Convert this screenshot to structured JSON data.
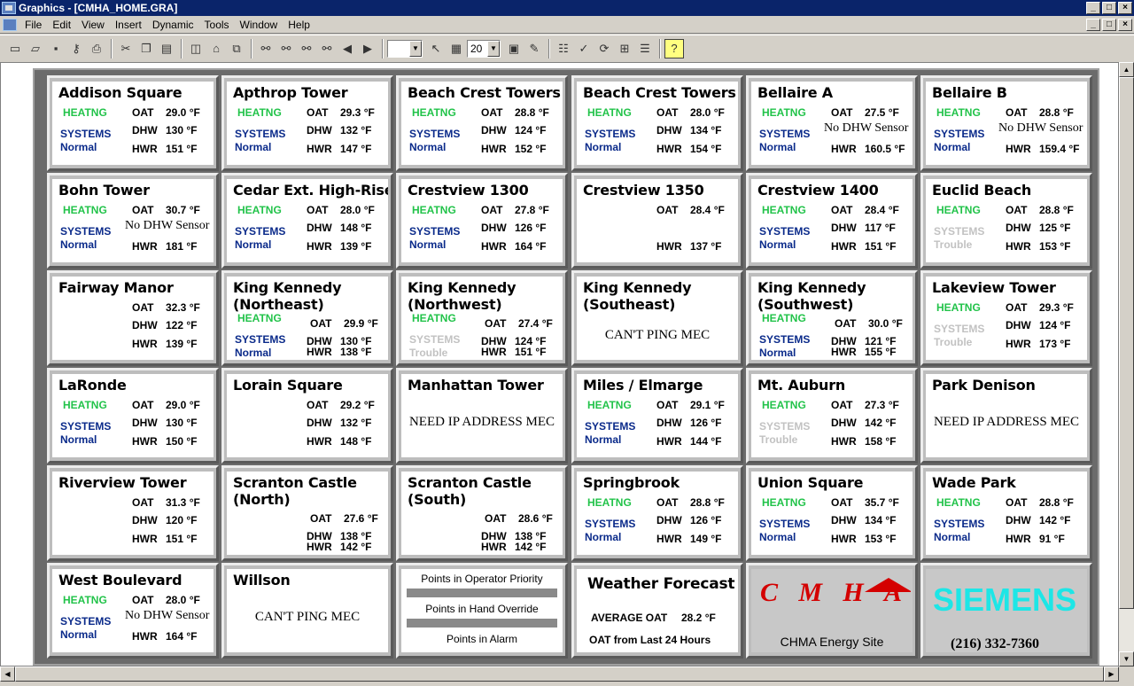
{
  "window": {
    "title": "Graphics - [CMHA_HOME.GRA]",
    "min": "_",
    "max": "□",
    "close": "×"
  },
  "menu": [
    "File",
    "Edit",
    "View",
    "Insert",
    "Dynamic",
    "Tools",
    "Window",
    "Help"
  ],
  "toolbar": {
    "zoom": "20"
  },
  "labels": {
    "oat": "OAT",
    "dhw": "DHW",
    "hwr": "HWR",
    "heating": "HEATNG",
    "systems": "SYSTEMS",
    "normal": "Normal",
    "trouble": "Trouble"
  },
  "buildings": [
    {
      "name": "Addison Square",
      "oat": "29.0 °F",
      "dhw": "130 °F",
      "hwr": "151 °F",
      "heating": true,
      "status": "Normal"
    },
    {
      "name": "Apthrop Tower",
      "oat": "29.3 °F",
      "dhw": "132 °F",
      "hwr": "147 °F",
      "heating": true,
      "status": "Normal"
    },
    {
      "name": "Beach Crest Towers A",
      "oat": "28.8 °F",
      "dhw": "124 °F",
      "hwr": "152 °F",
      "heating": true,
      "status": "Normal"
    },
    {
      "name": "Beach Crest Towers B",
      "oat": "28.0 °F",
      "dhw": "134 °F",
      "hwr": "154 °F",
      "heating": true,
      "status": "Normal"
    },
    {
      "name": "Bellaire A",
      "oat": "27.5 °F",
      "dhw_note": "No DHW Sensor",
      "hwr": "160.5 °F",
      "heating": true,
      "status": "Normal"
    },
    {
      "name": "Bellaire B",
      "oat": "28.8 °F",
      "dhw_note": "No DHW Sensor",
      "hwr": "159.4 °F",
      "heating": true,
      "status": "Normal"
    },
    {
      "name": "Bohn Tower",
      "oat": "30.7 °F",
      "dhw_note": "No DHW Sensor",
      "hwr": "181 °F",
      "heating": true,
      "status": "Normal"
    },
    {
      "name": "Cedar Ext. High-Rise",
      "oat": "28.0 °F",
      "dhw": "148 °F",
      "hwr": "139 °F",
      "heating": true,
      "status": "Normal"
    },
    {
      "name": "Crestview 1300",
      "oat": "27.8 °F",
      "dhw": "126 °F",
      "hwr": "164 °F",
      "heating": true,
      "status": "Normal"
    },
    {
      "name": "Crestview 1350",
      "oat": "28.4 °F",
      "hwr": "137 °F"
    },
    {
      "name": "Crestview 1400",
      "oat": "28.4 °F",
      "dhw": "117 °F",
      "hwr": "151 °F",
      "heating": true,
      "status": "Normal"
    },
    {
      "name": "Euclid Beach",
      "oat": "28.8 °F",
      "dhw": "125 °F",
      "hwr": "153 °F",
      "heating": true,
      "status": "Trouble"
    },
    {
      "name": "Fairway Manor",
      "oat": "32.3 °F",
      "dhw": "122 °F",
      "hwr": "139 °F"
    },
    {
      "name": "King Kennedy\n(Northeast)",
      "oat": "29.9 °F",
      "dhw": "130 °F",
      "hwr": "138 °F",
      "heating": true,
      "status": "Normal"
    },
    {
      "name": "King Kennedy\n(Northwest)",
      "oat": "27.4 °F",
      "dhw": "124 °F",
      "hwr": "151 °F",
      "heating": true,
      "status": "Trouble"
    },
    {
      "name": "King Kennedy\n(Southeast)",
      "message": "CAN'T PING MEC"
    },
    {
      "name": "King Kennedy\n(Southwest)",
      "oat": "30.0 °F",
      "dhw": "121 °F",
      "hwr": "155 °F",
      "heating": true,
      "status": "Normal"
    },
    {
      "name": "Lakeview Tower",
      "oat": "29.3 °F",
      "dhw": "124 °F",
      "hwr": "173 °F",
      "heating": true,
      "status": "Trouble"
    },
    {
      "name": "LaRonde",
      "oat": "29.0 °F",
      "dhw": "130 °F",
      "hwr": "150 °F",
      "heating": true,
      "status": "Normal"
    },
    {
      "name": "Lorain Square",
      "oat": "29.2 °F",
      "dhw": "132 °F",
      "hwr": "148 °F"
    },
    {
      "name": "Manhattan Tower",
      "message": "NEED IP ADDRESS MEC"
    },
    {
      "name": "Miles / Elmarge",
      "oat": "29.1 °F",
      "dhw": "126 °F",
      "hwr": "144 °F",
      "heating": true,
      "status": "Normal"
    },
    {
      "name": "Mt. Auburn",
      "oat": "27.3 °F",
      "dhw": "142 °F",
      "hwr": "158 °F",
      "heating": true,
      "status": "Trouble"
    },
    {
      "name": "Park Denison",
      "message": "NEED IP ADDRESS MEC"
    },
    {
      "name": "Riverview Tower",
      "oat": "31.3 °F",
      "dhw": "120 °F",
      "hwr": "151 °F"
    },
    {
      "name": "Scranton Castle\n(North)",
      "oat": "27.6 °F",
      "dhw": "138 °F",
      "hwr": "142 °F"
    },
    {
      "name": "Scranton Castle\n(South)",
      "oat": "28.6 °F",
      "dhw": "138 °F",
      "hwr": "142 °F"
    },
    {
      "name": "Springbrook",
      "oat": "28.8 °F",
      "dhw": "126 °F",
      "hwr": "149 °F",
      "heating": true,
      "status": "Normal"
    },
    {
      "name": "Union Square",
      "oat": "35.7 °F",
      "dhw": "134 °F",
      "hwr": "153 °F",
      "heating": true,
      "status": "Normal"
    },
    {
      "name": "Wade Park",
      "oat": "28.8 °F",
      "dhw": "142 °F",
      "hwr": "91 °F",
      "heating": true,
      "status": "Normal"
    },
    {
      "name": "West Boulevard",
      "oat": "28.0 °F",
      "dhw_note": "No DHW Sensor",
      "hwr": "164 °F",
      "heating": true,
      "status": "Normal"
    },
    {
      "name": "Willson",
      "message": "CAN'T PING MEC"
    }
  ],
  "points": {
    "priority": "Points in Operator Priority",
    "override": "Points in Hand Override",
    "alarm": "Points in Alarm"
  },
  "weather": {
    "title": "Weather Forecast",
    "avg_label": "AVERAGE OAT",
    "avg_value": "28.2 °F",
    "note": "OAT from Last 24 Hours"
  },
  "cmha": {
    "logo_text": "CMHA",
    "site": "CHMA Energy Site"
  },
  "siemens": {
    "logo": "SIEMENS",
    "phone": "(216) 332-7360"
  },
  "colors": {
    "board": "#6b6b6b",
    "heating": "#22c34a",
    "systems": "#0a2a8a",
    "trouble": "#c2c2c2",
    "cmha_red": "#d40000",
    "siemens": "#1de6e6"
  }
}
